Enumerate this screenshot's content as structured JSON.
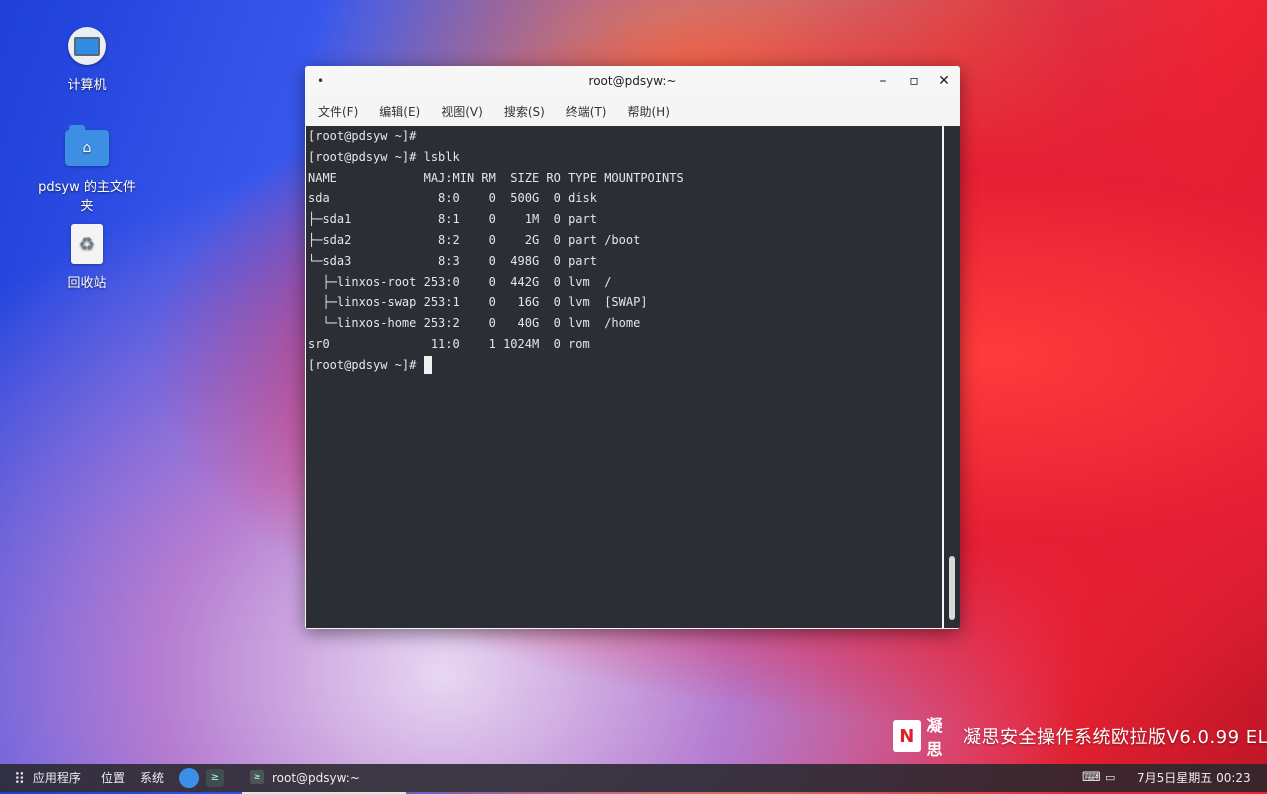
{
  "desktop": {
    "icons": [
      {
        "label": "计算机",
        "icon": "computer-icon"
      },
      {
        "label": "pdsyw 的主文件夹",
        "icon": "home-folder-icon"
      },
      {
        "label": "回收站",
        "icon": "trash-icon"
      }
    ]
  },
  "window": {
    "title": "root@pdsyw:~",
    "menus": [
      "文件(F)",
      "编辑(E)",
      "视图(V)",
      "搜索(S)",
      "终端(T)",
      "帮助(H)"
    ],
    "controls": {
      "minimize": "–",
      "maximize": "▫",
      "close": "✕"
    }
  },
  "terminal": {
    "lines": [
      "[root@pdsyw ~]#",
      "[root@pdsyw ~]# lsblk",
      "NAME            MAJ:MIN RM  SIZE RO TYPE MOUNTPOINTS",
      "sda               8:0    0  500G  0 disk",
      "├─sda1            8:1    0    1M  0 part",
      "├─sda2            8:2    0    2G  0 part /boot",
      "└─sda3            8:3    0  498G  0 part",
      "  ├─linxos-root 253:0    0  442G  0 lvm  /",
      "  ├─linxos-swap 253:1    0   16G  0 lvm  [SWAP]",
      "  └─linxos-home 253:2    0   40G  0 lvm  /home",
      "sr0              11:0    1 1024M  0 rom",
      "[root@pdsyw ~]# "
    ]
  },
  "brand": {
    "logo": "N",
    "logo_text": "凝思",
    "text": "凝思安全操作系统欧拉版V6.0.99 EL"
  },
  "taskbar": {
    "apps_label": "应用程序",
    "places_label": "位置",
    "system_label": "系统",
    "task_title": "root@pdsyw:~",
    "clock": "7月5日星期五 00:23"
  }
}
